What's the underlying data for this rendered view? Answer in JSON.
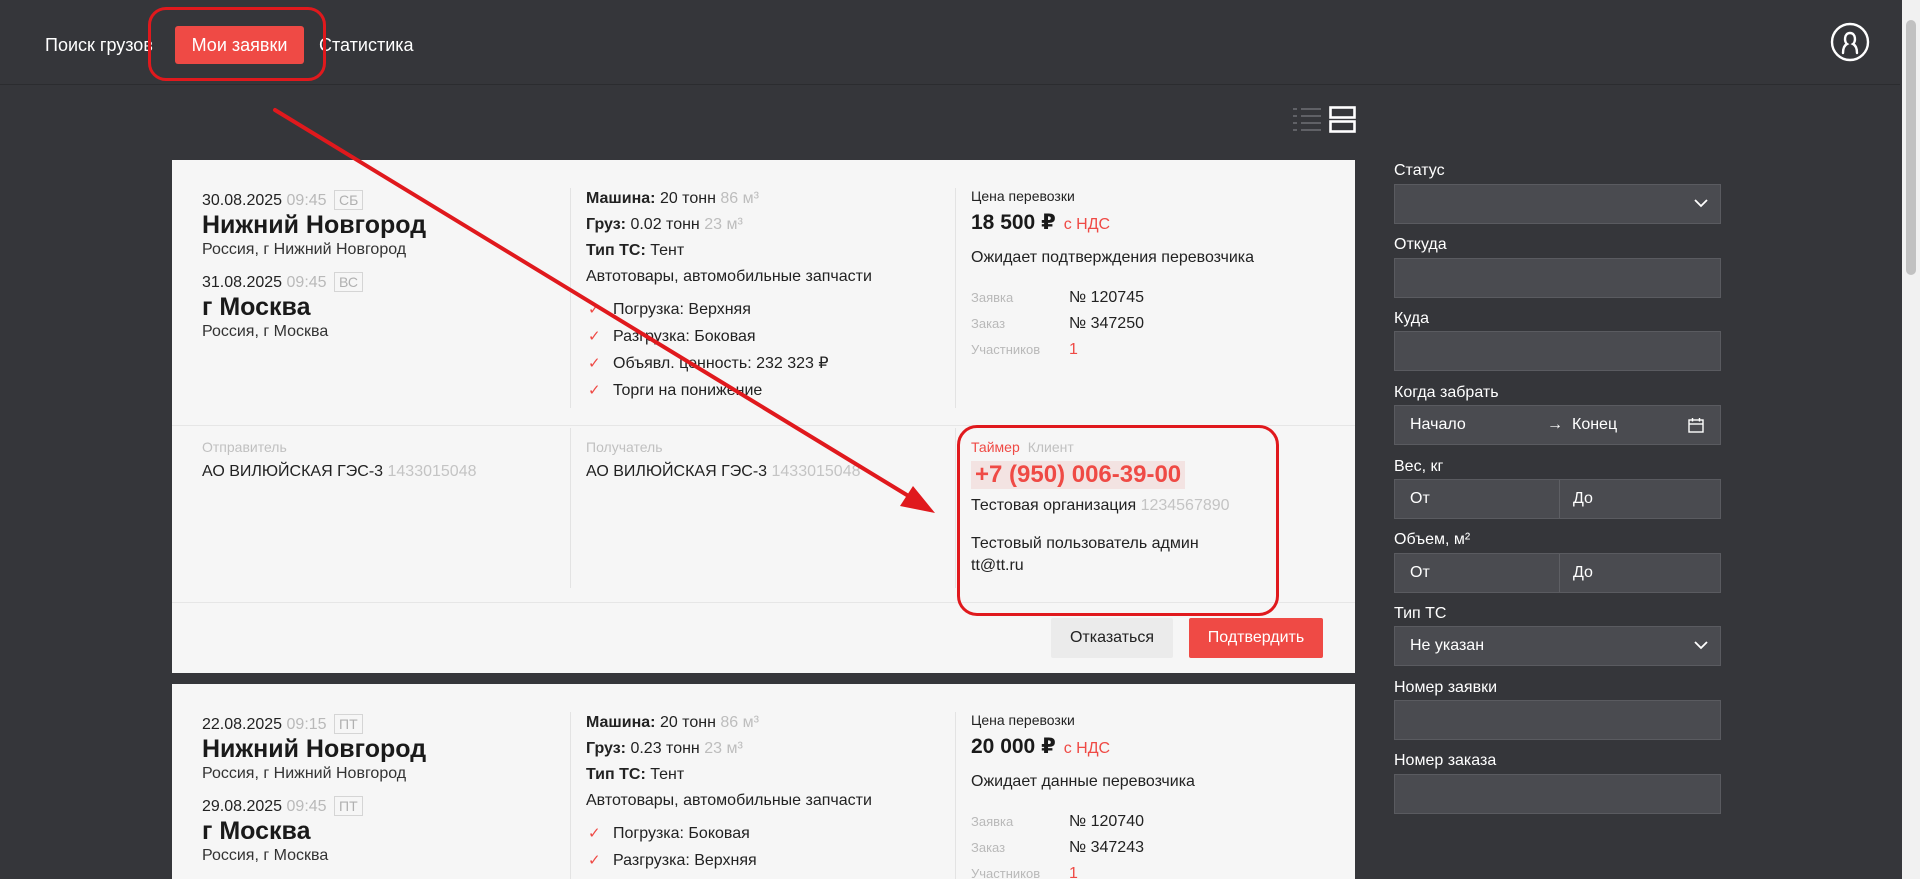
{
  "nav": {
    "items": [
      "Поиск грузов",
      "Мои заявки",
      "Статистика"
    ],
    "active": "Мои заявки"
  },
  "colors": {
    "accent": "#ef4a45",
    "background": "#35363a",
    "card": "#f6f6f6",
    "annotation": "#e0191d"
  },
  "icons": [
    "profile-icon",
    "list-view-icon",
    "card-view-icon",
    "chevron-down-icon",
    "calendar-icon",
    "check-icon"
  ],
  "orders": [
    {
      "from_date": "30.08.2025",
      "from_time": "09:45",
      "from_dow": "СБ",
      "from_city": "Нижний Новгород",
      "from_addr": "Россия, г Нижний Новгород",
      "to_date": "31.08.2025",
      "to_time": "09:45",
      "to_dow": "ВС",
      "to_city": "г Москва",
      "to_addr": "Россия, г Москва",
      "machine_label": "Машина:",
      "machine_value": "20 тонн",
      "machine_volume": "86 м³",
      "cargo_label": "Груз:",
      "cargo_value": "0.02 тонн",
      "cargo_volume": "23 м³",
      "vehicle_label": "Тип ТС:",
      "vehicle_value": "Тент",
      "goods": "Автотовары, автомобильные запчасти",
      "conditions": [
        "Погрузка: Верхняя",
        "Разгрузка: Боковая",
        "Объявл. ценность: 232 323 ₽",
        "Торги на понижение"
      ],
      "price_label": "Цена перевозки",
      "price": "18 500 ₽",
      "vat": "с НДС",
      "status": "Ожидает подтверждения перевозчика",
      "request_label": "Заявка",
      "request_no": "№ 120745",
      "order_label": "Заказ",
      "order_no": "№ 347250",
      "participants_label": "Участников",
      "participants": "1",
      "sender_label": "Отправитель",
      "sender": "АО ВИЛЮЙСКАЯ ГЭС-3",
      "sender_inn": "1433015048",
      "receiver_label": "Получатель",
      "receiver": "АО ВИЛЮЙСКАЯ ГЭС-3",
      "receiver_inn": "1433015048",
      "contact_tab_active": "Таймер",
      "contact_tab_inactive": "Клиент",
      "phone": "+7 (950) 006-39-00",
      "org": "Тестовая организация",
      "org_inn": "1234567890",
      "user": "Тестовый пользователь админ",
      "email": "tt@tt.ru",
      "decline_label": "Отказаться",
      "confirm_label": "Подтвердить"
    },
    {
      "from_date": "22.08.2025",
      "from_time": "09:15",
      "from_dow": "ПТ",
      "from_city": "Нижний Новгород",
      "from_addr": "Россия, г Нижний Новгород",
      "to_date": "29.08.2025",
      "to_time": "09:45",
      "to_dow": "ПТ",
      "to_city": "г Москва",
      "to_addr": "Россия, г Москва",
      "machine_label": "Машина:",
      "machine_value": "20 тонн",
      "machine_volume": "86 м³",
      "cargo_label": "Груз:",
      "cargo_value": "0.23 тонн",
      "cargo_volume": "23 м³",
      "vehicle_label": "Тип ТС:",
      "vehicle_value": "Тент",
      "goods": "Автотовары, автомобильные запчасти",
      "conditions": [
        "Погрузка: Боковая",
        "Разгрузка: Верхняя"
      ],
      "price_label": "Цена перевозки",
      "price": "20 000 ₽",
      "vat": "с НДС",
      "status": "Ожидает данные перевозчика",
      "request_label": "Заявка",
      "request_no": "№ 120740",
      "order_label": "Заказ",
      "order_no": "№ 347243",
      "participants_label": "Участников",
      "participants": "1"
    }
  ],
  "filters": {
    "status_label": "Статус",
    "from_label": "Откуда",
    "to_label": "Куда",
    "pickup_label": "Когда забрать",
    "start_placeholder": "Начало",
    "end_placeholder": "Конец",
    "weight_label": "Вес, кг",
    "volume_label": "Объем, м²",
    "from_placeholder": "От",
    "to_placeholder": "До",
    "vehicle_label": "Тип ТС",
    "vehicle_value": "Не указан",
    "request_no_label": "Номер заявки",
    "order_no_label": "Номер заказа"
  }
}
